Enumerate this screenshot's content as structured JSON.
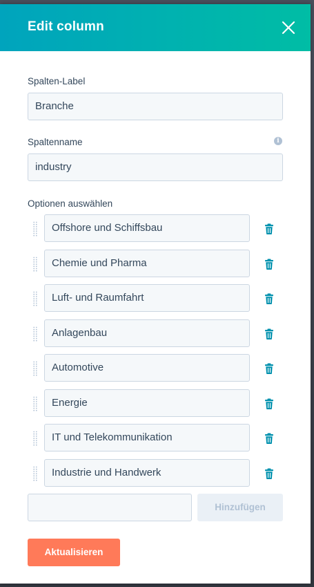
{
  "modal": {
    "title": "Edit column"
  },
  "column_label": {
    "label": "Spalten-Label",
    "value": "Branche"
  },
  "column_name": {
    "label": "Spaltenname",
    "value": "industry",
    "info_icon": "info-icon"
  },
  "options": {
    "label": "Optionen auswählen",
    "items": [
      {
        "label": "Offshore und Schiffsbau"
      },
      {
        "label": "Chemie und Pharma"
      },
      {
        "label": "Luft- und Raumfahrt"
      },
      {
        "label": "Anlagenbau"
      },
      {
        "label": "Automotive"
      },
      {
        "label": "Energie"
      },
      {
        "label": "IT und Telekommunikation"
      },
      {
        "label": "Industrie und Handwerk"
      }
    ],
    "new_option_value": "",
    "add_label": "Hinzufügen"
  },
  "actions": {
    "update_label": "Aktualisieren"
  },
  "colors": {
    "header_gradient_start": "#00a4bd",
    "header_gradient_end": "#00bda5",
    "trash_icon": "#0091ae",
    "primary_button": "#ff7a59",
    "text": "#33475b"
  }
}
